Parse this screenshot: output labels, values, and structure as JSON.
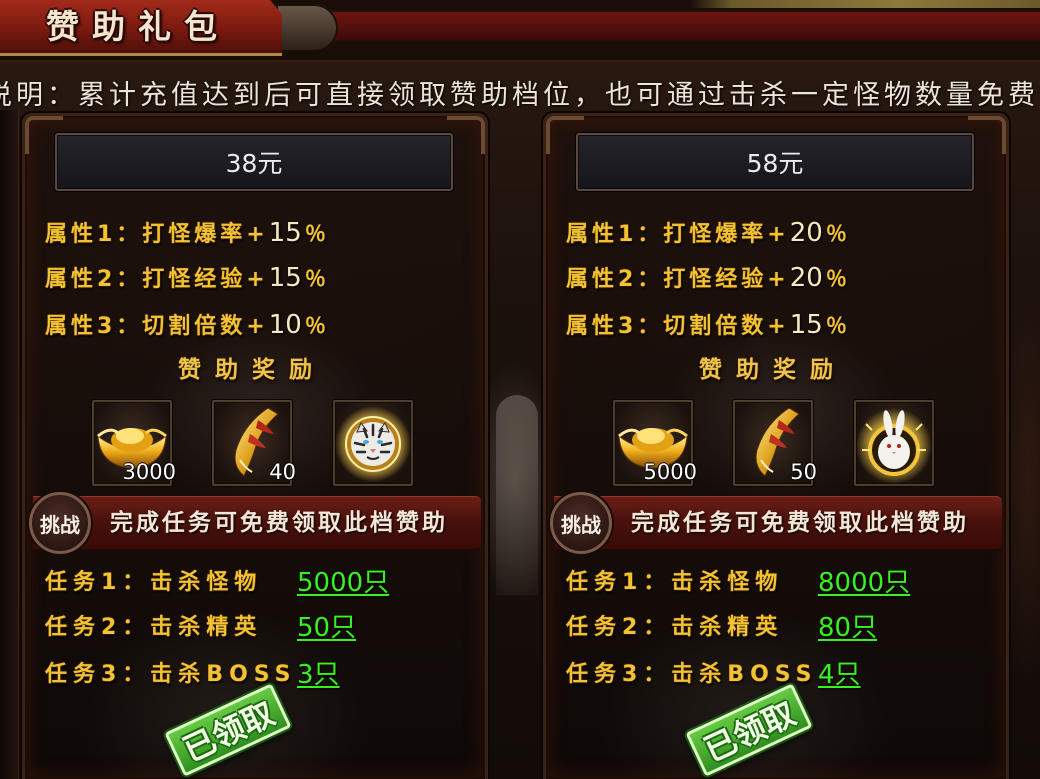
{
  "window": {
    "title": "赞助礼包"
  },
  "description": "说明：累计充值达到后可直接领取赞助档位，也可通过击杀一定怪物数量免费领",
  "colors": {
    "attribute_gold": "#f2c233",
    "task_link_green": "#38f21f",
    "challenge_bar_red": "#5a1610",
    "stamp_green": "#3fa82a",
    "title_tab_red": "#8e1f14"
  },
  "tiers": [
    {
      "price": "38元",
      "attributes": [
        {
          "label": "属性1：打怪爆率+",
          "value": "15",
          "unit": "％"
        },
        {
          "label": "属性2：打怪经验+",
          "value": "15",
          "unit": "％"
        },
        {
          "label": "属性3：切割倍数+",
          "value": "10",
          "unit": "％"
        }
      ],
      "rewards_title": "赞助奖励",
      "rewards": [
        {
          "icon": "gold-ingot-icon",
          "count": "3000"
        },
        {
          "icon": "horn-icon",
          "count": "40"
        },
        {
          "icon": "tiger-medallion-icon"
        }
      ],
      "challenge_badge": "挑战",
      "challenge_text": "完成任务可免费领取此档赞助",
      "tasks": [
        {
          "label": "任务1：击杀怪物",
          "value": "5000只"
        },
        {
          "label": "任务2：击杀精英",
          "value": "50只"
        },
        {
          "label": "任务3：击杀BOSS",
          "value": "3只"
        }
      ],
      "status": "已领取"
    },
    {
      "price": "58元",
      "attributes": [
        {
          "label": "属性1：打怪爆率+",
          "value": "20",
          "unit": "％"
        },
        {
          "label": "属性2：打怪经验+",
          "value": "20",
          "unit": "％"
        },
        {
          "label": "属性3：切割倍数+",
          "value": "15",
          "unit": "％"
        }
      ],
      "rewards_title": "赞助奖励",
      "rewards": [
        {
          "icon": "gold-ingot-icon",
          "count": "5000"
        },
        {
          "icon": "horn-icon",
          "count": "50"
        },
        {
          "icon": "rabbit-medallion-icon"
        }
      ],
      "challenge_badge": "挑战",
      "challenge_text": "完成任务可免费领取此档赞助",
      "tasks": [
        {
          "label": "任务1：击杀怪物",
          "value": "8000只"
        },
        {
          "label": "任务2：击杀精英",
          "value": "80只"
        },
        {
          "label": "任务3：击杀BOSS",
          "value": "4只"
        }
      ],
      "status": "已领取"
    }
  ]
}
